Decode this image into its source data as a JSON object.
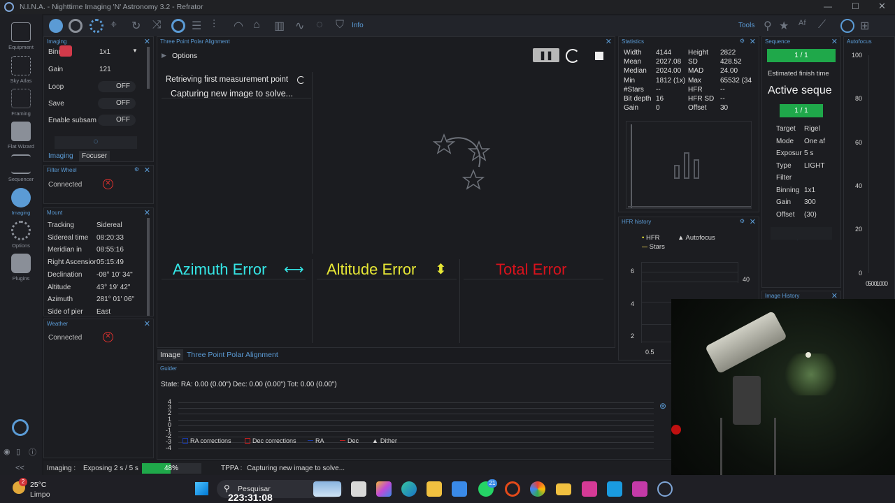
{
  "titlebar": {
    "title": "N.I.N.A. - Nighttime Imaging 'N' Astronomy 3.2 - Refrator"
  },
  "toolbar": {
    "info_label": "Info",
    "tools_label": "Tools"
  },
  "leftnav": {
    "items": [
      "Equipment",
      "Sky Atlas",
      "Framing",
      "Flat Wizard",
      "Sequencer",
      "Imaging",
      "Options",
      "Plugins"
    ]
  },
  "imaging_panel": {
    "title": "Imaging",
    "binning_label": "Binning",
    "binning_value": "1x1",
    "gain_label": "Gain",
    "gain_value": "121",
    "loop_label": "Loop",
    "loop_value": "OFF",
    "save_label": "Save",
    "save_value": "OFF",
    "subsample_label": "Enable subsam",
    "subsample_value": "OFF",
    "tab_imaging": "Imaging",
    "tab_focuser": "Focuser"
  },
  "filterwheel_panel": {
    "title": "Filter Wheel",
    "status": "Connected"
  },
  "mount_panel": {
    "title": "Mount",
    "rows": [
      {
        "label": "Tracking",
        "value": "Sidereal"
      },
      {
        "label": "Sidereal time",
        "value": "08:20:33"
      },
      {
        "label": "Meridian in",
        "value": "08:55:16"
      },
      {
        "label": "Right Ascension",
        "value": "05:15:49"
      },
      {
        "label": "Declination",
        "value": "-08° 10' 34\""
      },
      {
        "label": "Altitude",
        "value": "43° 19' 42\""
      },
      {
        "label": "Azimuth",
        "value": "281° 01' 06\""
      },
      {
        "label": "Side of pier",
        "value": "East"
      }
    ]
  },
  "weather_panel": {
    "title": "Weather",
    "status": "Connected"
  },
  "tppa": {
    "title": "Three Point Polar Alignment",
    "options_label": "Options",
    "status_line1": "Retrieving first measurement point",
    "status_line2": "Capturing new image to solve...",
    "azimuth_error": "Azimuth Error",
    "altitude_error": "Altitude Error",
    "total_error": "Total Error",
    "tab_image": "Image",
    "tab_tppa": "Three Point Polar Alignment",
    "colors": {
      "azimuth": "#35e6e6",
      "altitude": "#e6e635",
      "total": "#d8121c"
    }
  },
  "statistics": {
    "title": "Statistics",
    "left": [
      {
        "label": "Width",
        "value": "4144"
      },
      {
        "label": "Mean",
        "value": "2027.08"
      },
      {
        "label": "Median",
        "value": "2024.00"
      },
      {
        "label": "Min",
        "value": "1812 (1x)"
      },
      {
        "label": "#Stars",
        "value": "--"
      },
      {
        "label": "Bit depth",
        "value": "16"
      },
      {
        "label": "Gain",
        "value": "0"
      }
    ],
    "right": [
      {
        "label": "Height",
        "value": "2822"
      },
      {
        "label": "SD",
        "value": "428.52"
      },
      {
        "label": "MAD",
        "value": "24.00"
      },
      {
        "label": "Max",
        "value": "65532 (34"
      },
      {
        "label": "HFR",
        "value": "--"
      },
      {
        "label": "HFR SD",
        "value": "--"
      },
      {
        "label": "Offset",
        "value": "30"
      }
    ]
  },
  "hfr_history": {
    "title": "HFR history",
    "legend_hfr": "HFR",
    "legend_autofocus": "Autofocus",
    "legend_stars": "Stars",
    "yticks": [
      "6",
      "4",
      "2"
    ],
    "right_tick": "40",
    "xtick": "0.5"
  },
  "sequence": {
    "title": "Sequence",
    "progress": "1 / 1",
    "estimated_label": "Estimated finish time",
    "active_label": "Active seque",
    "progress2": "1 / 1",
    "rows": [
      {
        "label": "Target",
        "value": "Rigel"
      },
      {
        "label": "Mode",
        "value": "One af"
      },
      {
        "label": "Exposur",
        "value": "5 s"
      },
      {
        "label": "Type",
        "value": "LIGHT"
      },
      {
        "label": "Filter",
        "value": ""
      },
      {
        "label": "Binning",
        "value": "1x1"
      },
      {
        "label": "Gain",
        "value": "300"
      },
      {
        "label": "Offset",
        "value": "(30)"
      }
    ],
    "image_history_title": "Image History"
  },
  "autofocus": {
    "title": "Autofocus",
    "yticks": [
      "100",
      "80",
      "60",
      "40",
      "20",
      "0"
    ],
    "xticks": "0 500 1000"
  },
  "guider": {
    "title": "Guider",
    "state": "State:  RA: 0.00 (0.00\")  Dec: 0.00 (0.00\")  Tot: 0.00 (0.00\")",
    "yticks": [
      "4",
      "3",
      "2",
      "1",
      "0",
      "-1",
      "-2",
      "-3",
      "-4"
    ],
    "legend": [
      "RA corrections",
      "Dec corrections",
      "RA",
      "Dec",
      "Dither"
    ]
  },
  "statusbar": {
    "imaging_label": "Imaging :",
    "exposing_text": "Exposing 2 s / 5 s",
    "progress_text": "48%",
    "progress": 0.48,
    "tppa_label": "TPPA :",
    "tppa_text": "Capturing new image to solve..."
  },
  "taskbar": {
    "temperature": "25°C",
    "weather": "Limpo",
    "weather_badge": "2",
    "search_placeholder": "Pesquisar",
    "clock": "223:31:08",
    "whatsapp_badge": "21"
  }
}
